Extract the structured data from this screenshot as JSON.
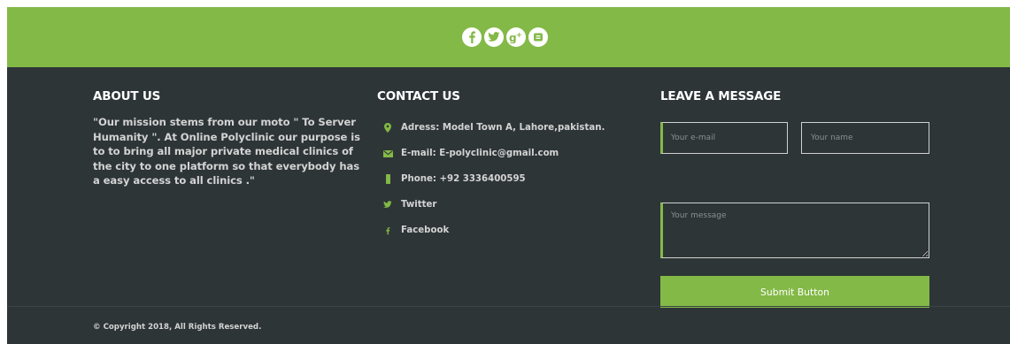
{
  "social": {
    "icons": [
      "facebook-icon",
      "twitter-icon",
      "google-plus-icon",
      "contact-icon"
    ],
    "bar_color": "#83b947"
  },
  "about": {
    "title": "ABOUT US",
    "text": "\"Our mission stems from our moto \" To Server Humanity \". At Online Polyclinic our purpose is to to bring all major private medical clinics of the city to one platform so that everybody has a easy access to all clinics .\""
  },
  "contact": {
    "title": "CONTACT US",
    "items": [
      {
        "icon": "map-pin-icon",
        "label": "Adress: Model Town A, Lahore,pakistan."
      },
      {
        "icon": "envelope-icon",
        "label": "E-mail: E-polyclinic@gmail.com"
      },
      {
        "icon": "phone-icon",
        "label": "Phone: +92 3336400595"
      },
      {
        "icon": "twitter-icon",
        "label": "Twitter"
      },
      {
        "icon": "facebook-icon",
        "label": "Facebook"
      }
    ]
  },
  "message": {
    "title": "LEAVE A MESSAGE",
    "email_placeholder": "Your e-mail",
    "name_placeholder": "Your name",
    "message_placeholder": "Your message",
    "submit_label": "Submit Button"
  },
  "footer": {
    "copyright": "© Copyright 2018, All Rights Reserved."
  },
  "colors": {
    "accent": "#83b947",
    "background": "#2e3537",
    "text": "#d3d3d3"
  }
}
